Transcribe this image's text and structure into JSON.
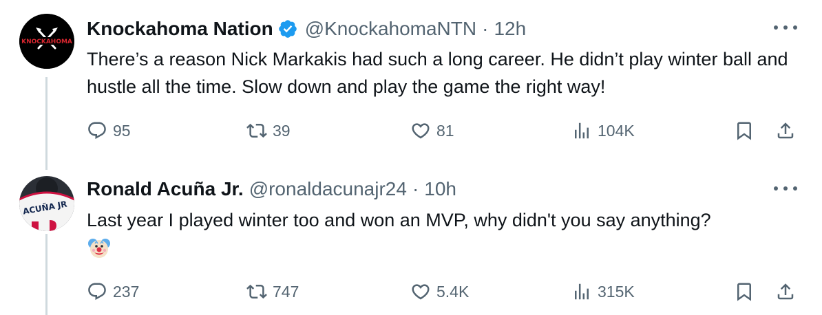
{
  "tweets": [
    {
      "name": "Knockahoma Nation",
      "handle": "@KnockahomaNTN",
      "separator": "·",
      "time": "12h",
      "avatar_text": "KNOCKAHOMA",
      "text": "There’s a reason Nick Markakis had such a long career. He didn’t play winter ball and hustle all the time. Slow down and play the game the right way!",
      "replies": "95",
      "retweets": "39",
      "likes": "81",
      "views": "104K"
    },
    {
      "name": "Ronald Acuña Jr.",
      "handle": "@ronaldacunajr24",
      "separator": "·",
      "time": "10h",
      "avatar_text": "ACUÑA JR",
      "text": "Last year I played winter too and won an MVP, why didn't you say anything?",
      "emoji": "clown-face",
      "replies": "237",
      "retweets": "747",
      "likes": "5.4K",
      "views": "315K"
    }
  ],
  "colors": {
    "verified": "#1d9bf0",
    "muted": "#536471",
    "text": "#0f1419",
    "thread_line": "#cfd9de"
  },
  "icons": [
    "reply-icon",
    "retweet-icon",
    "like-icon",
    "views-icon",
    "bookmark-icon",
    "share-icon",
    "more-icon",
    "verified-badge-icon"
  ]
}
